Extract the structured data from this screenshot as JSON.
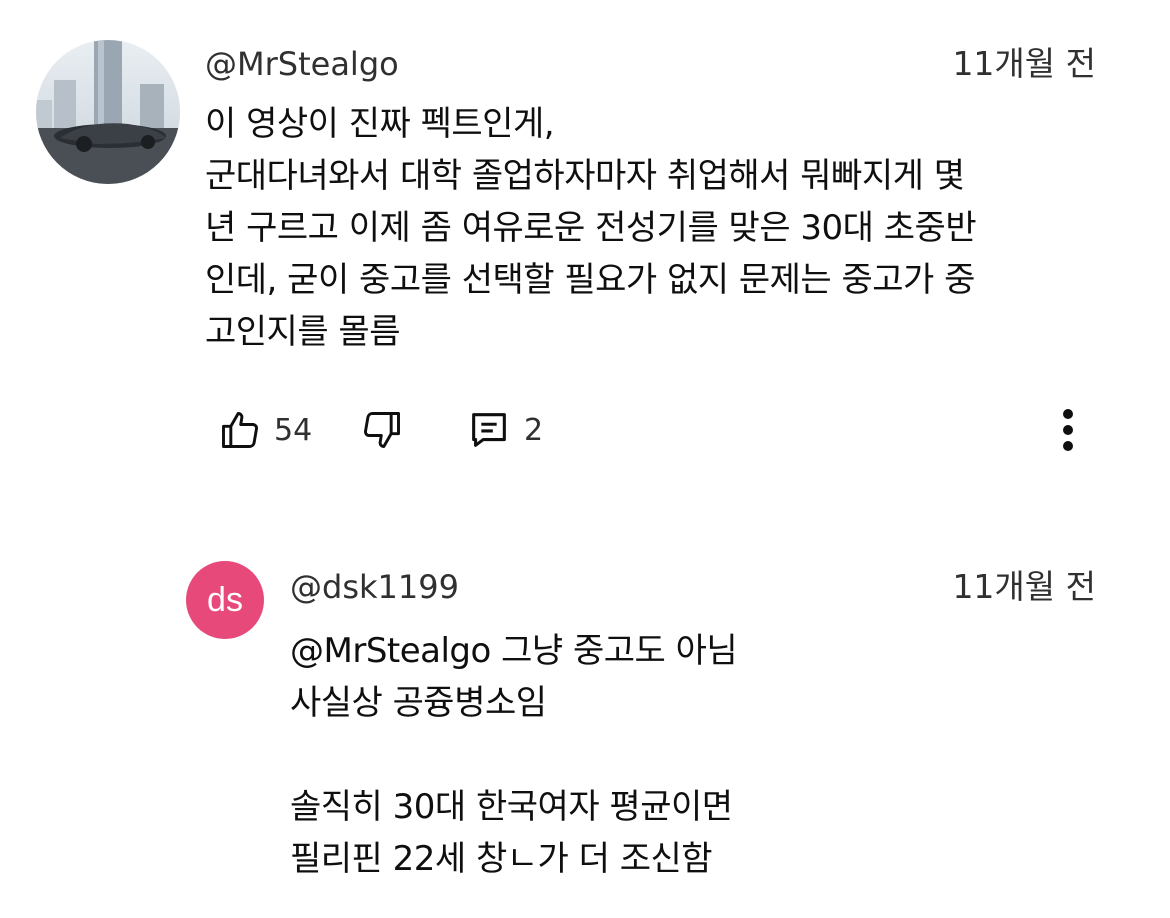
{
  "comment": {
    "handle": "@MrStealgo",
    "time": "11개월 전",
    "text": "이 영상이 진짜 펙트인게,\n군대다녀와서 대학 졸업하자마자 취업해서 뭐빠지게 몇\n년 구르고 이제 좀 여유로운 전성기를 맞은 30대 초중반\n인데, 굳이 중고를 선택할 필요가 없지 문제는 중고가 중\n고인지를 몰름",
    "likes": "54",
    "replies": "2"
  },
  "reply": {
    "avatar_letters": "ds",
    "handle": "@dsk1199",
    "time": "11개월 전",
    "text": "@MrStealgo 그냥 중고도 아님\n사실상 공즁병소임\n\n솔직히 30대 한국여자 평균이면\n필리핀 22세 창ㄴ가 더 조신함",
    "avatar_color": "#e8497b"
  }
}
